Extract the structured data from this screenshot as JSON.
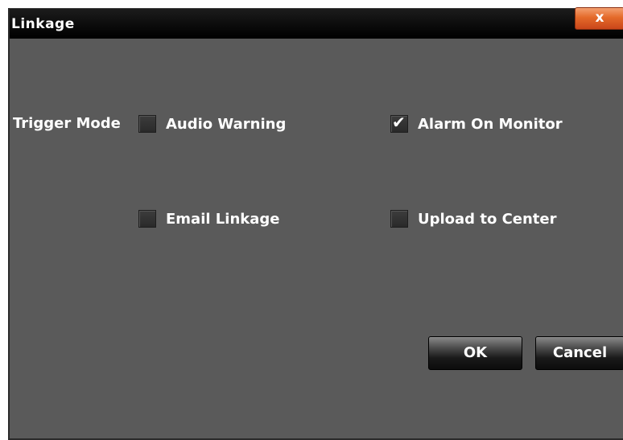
{
  "window": {
    "title": "Linkage",
    "close_label": "x"
  },
  "trigger": {
    "label": "Trigger Mode",
    "options": [
      {
        "label": "Audio Warning",
        "checked": false
      },
      {
        "label": "Alarm On Monitor",
        "checked": true
      },
      {
        "label": "Email Linkage",
        "checked": false
      },
      {
        "label": "Upload to Center",
        "checked": false
      }
    ],
    "check_glyph": "✔"
  },
  "buttons": {
    "ok": "OK",
    "cancel": "Cancel"
  }
}
